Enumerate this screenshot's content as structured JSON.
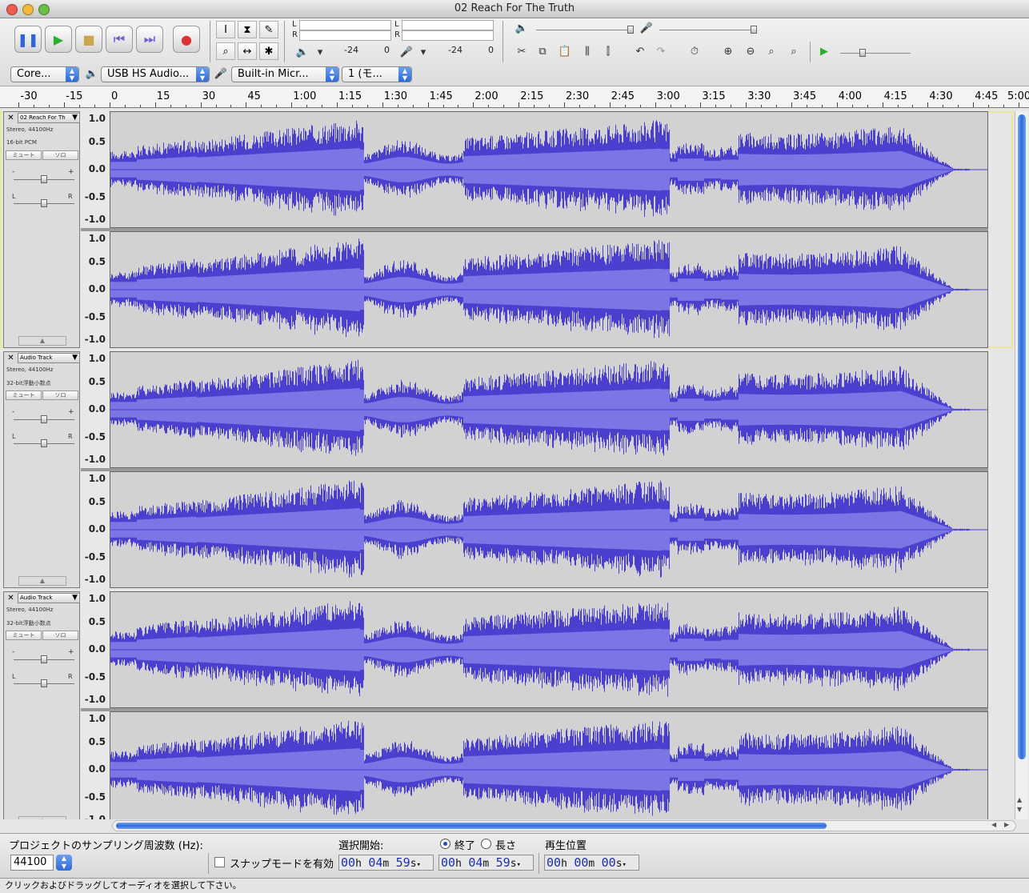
{
  "window": {
    "title": "02 Reach For The Truth"
  },
  "transport": {
    "pause": "pause",
    "play": "play",
    "stop": "stop",
    "skip_start": "skip-to-start",
    "skip_end": "skip-to-end",
    "record": "record"
  },
  "meters": {
    "left_label": "L",
    "right_label": "R",
    "play_scale": [
      "-24",
      "0"
    ],
    "rec_scale": [
      "-24",
      "0"
    ]
  },
  "devices": {
    "host": "Core...",
    "output": "USB HS Audio...",
    "input": "Built-in Micr...",
    "channels": "1 (モ..."
  },
  "ruler": {
    "labels": [
      "-30",
      "-15",
      "0",
      "15",
      "30",
      "45",
      "1:00",
      "1:15",
      "1:30",
      "1:45",
      "2:00",
      "2:15",
      "2:30",
      "2:45",
      "3:00",
      "3:15",
      "3:30",
      "3:45",
      "4:00",
      "4:15",
      "4:30",
      "4:45",
      "5:00"
    ]
  },
  "tracks": [
    {
      "name": "02 Reach For Th",
      "info1": "Stereo, 44100Hz",
      "info2": "16-bit PCM",
      "mute": "ミュート",
      "solo": "ソロ",
      "gain_minus": "-",
      "gain_plus": "+",
      "pan_left": "L",
      "pan_right": "R"
    },
    {
      "name": "Audio Track",
      "info1": "Stereo, 44100Hz",
      "info2": "32-bit浮動小数点",
      "mute": "ミュート",
      "solo": "ソロ",
      "gain_minus": "-",
      "gain_plus": "+",
      "pan_left": "L",
      "pan_right": "R"
    },
    {
      "name": "Audio Track",
      "info1": "Stereo, 44100Hz",
      "info2": "32-bit浮動小数点",
      "mute": "ミュート",
      "solo": "ソロ",
      "gain_minus": "-",
      "gain_plus": "+",
      "pan_left": "L",
      "pan_right": "R"
    }
  ],
  "amplitude_labels": [
    "1.0",
    "0.5",
    "0.0",
    "-0.5",
    "-1.0"
  ],
  "bottom": {
    "rate_label": "プロジェクトのサンプリング周波数 (Hz):",
    "rate_value": "44100",
    "snap_label": "スナップモードを有効",
    "sel_start_label": "選択開始:",
    "end_label": "終了",
    "length_label": "長さ",
    "position_label": "再生位置",
    "sel_start": {
      "h": "00",
      "m": "04",
      "s": "59"
    },
    "sel_end": {
      "h": "00",
      "m": "04",
      "s": "59"
    },
    "position": {
      "h": "00",
      "m": "00",
      "s": "00"
    },
    "unit_h": "h",
    "unit_m": "m",
    "unit_s": "s"
  },
  "status": "クリックおよびドラッグしてオーディオを選択して下さい。",
  "colors": {
    "wave": "#4b3fcf",
    "wave_rms": "#7b76e6",
    "selected_track_border": "#e8e89a"
  }
}
